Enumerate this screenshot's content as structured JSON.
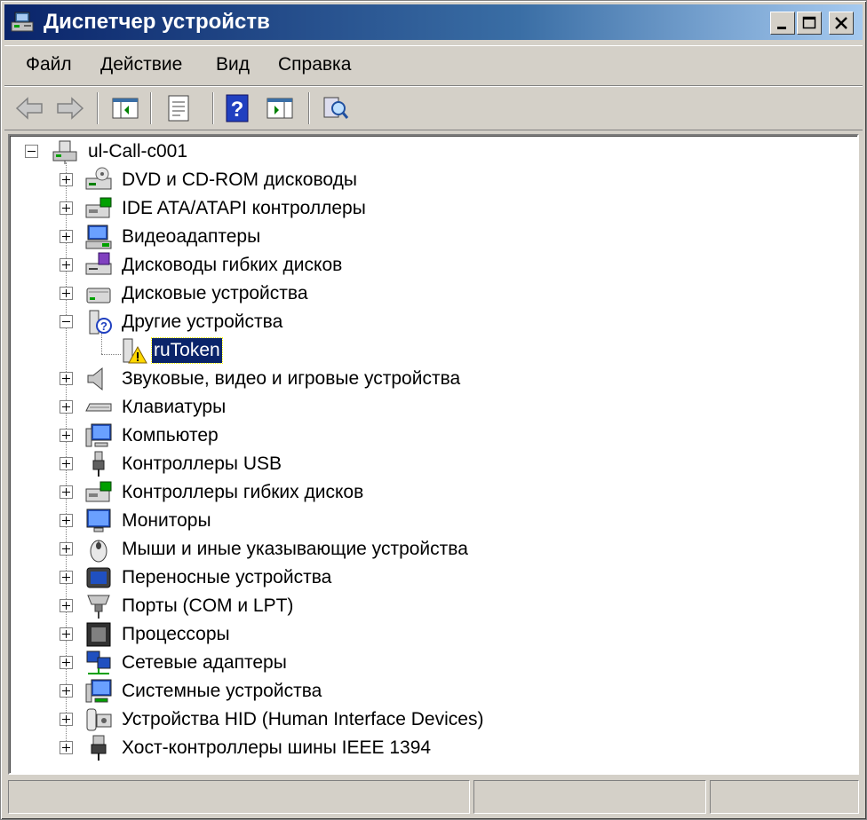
{
  "window": {
    "title": "Диспетчер устройств",
    "accent": "#0a246a"
  },
  "titlebar_buttons": [
    {
      "name": "minimize-icon"
    },
    {
      "name": "maximize-icon"
    },
    {
      "name": "close-icon"
    }
  ],
  "menu": [
    "Файл",
    "Действие",
    "Вид",
    "Справка"
  ],
  "toolbar": [
    {
      "name": "back-arrow-icon"
    },
    {
      "name": "forward-arrow-icon"
    },
    {
      "name": "show-hide-console-tree-icon"
    },
    {
      "name": "properties-icon"
    },
    {
      "name": "help-icon"
    },
    {
      "name": "update-driver-icon"
    },
    {
      "name": "scan-hardware-changes-icon"
    }
  ],
  "tree": {
    "root": "ul-Call-c001",
    "categories": [
      {
        "label": "DVD и CD-ROM дисководы",
        "icon": "cdrom-icon"
      },
      {
        "label": "IDE ATA/ATAPI контроллеры",
        "icon": "ide-controller-icon"
      },
      {
        "label": "Видеоадаптеры",
        "icon": "display-adapter-icon"
      },
      {
        "label": "Дисководы гибких дисков",
        "icon": "floppy-drive-icon"
      },
      {
        "label": "Дисковые устройства",
        "icon": "disk-drive-icon"
      },
      {
        "label": "Другие устройства",
        "icon": "unknown-device-icon",
        "expanded": true,
        "children": [
          {
            "label": "ruToken",
            "icon": "warning-device-icon",
            "selected": true
          }
        ]
      },
      {
        "label": "Звуковые, видео и игровые устройства",
        "icon": "speaker-icon"
      },
      {
        "label": "Клавиатуры",
        "icon": "keyboard-icon"
      },
      {
        "label": "Компьютер",
        "icon": "computer-icon"
      },
      {
        "label": "Контроллеры USB",
        "icon": "usb-icon"
      },
      {
        "label": "Контроллеры гибких дисков",
        "icon": "floppy-controller-icon"
      },
      {
        "label": "Мониторы",
        "icon": "monitor-icon"
      },
      {
        "label": "Мыши и иные указывающие устройства",
        "icon": "mouse-icon"
      },
      {
        "label": "Переносные устройства",
        "icon": "portable-device-icon"
      },
      {
        "label": "Порты (COM и LPT)",
        "icon": "port-icon"
      },
      {
        "label": "Процессоры",
        "icon": "processor-icon"
      },
      {
        "label": "Сетевые адаптеры",
        "icon": "network-adapter-icon"
      },
      {
        "label": "Системные устройства",
        "icon": "system-device-icon"
      },
      {
        "label": "Устройства HID (Human Interface Devices)",
        "icon": "hid-icon"
      },
      {
        "label": "Хост-контроллеры шины IEEE 1394",
        "icon": "ieee1394-icon"
      }
    ]
  },
  "statusbar": [
    "",
    "",
    ""
  ]
}
